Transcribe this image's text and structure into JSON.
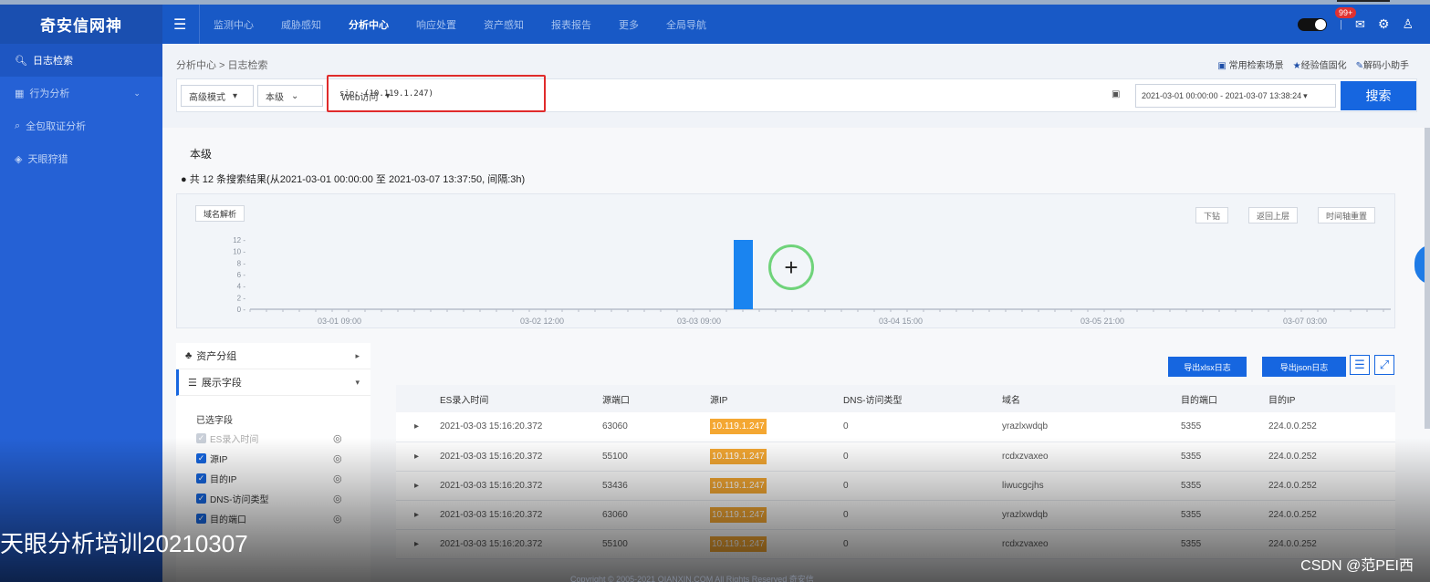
{
  "app": {
    "logo": "奇安信网神"
  },
  "nav": {
    "items": [
      "监测中心",
      "威胁感知",
      "分析中心",
      "响应处置",
      "资产感知",
      "报表报告",
      "更多",
      "全局导航"
    ],
    "active": "分析中心"
  },
  "header_right": {
    "badge": "99+"
  },
  "sidebar": {
    "items": [
      "日志检索",
      "行为分析",
      "全包取证分析",
      "天眼狩猎"
    ]
  },
  "breadcrumb": "分析中心 > 日志检索",
  "quick_links": [
    "常用检索场景",
    "经验值固化",
    "解码小助手"
  ],
  "search": {
    "mode": "高级模式",
    "level": "本级",
    "type": "Web访问",
    "query": "sip: (10.119.1.247)",
    "date_range": "2021-03-01 00:00:00 - 2021-03-07 13:38:24",
    "button": "搜索"
  },
  "result": {
    "level_title": "本级",
    "summary": "● 共 12 条搜索结果(从2021-03-01 00:00:00 至 2021-03-07 13:37:50, 间隔:3h)"
  },
  "chart": {
    "tag_button": "域名解析",
    "buttons": [
      "下钻",
      "返回上层",
      "时间轴重置"
    ]
  },
  "chart_data": {
    "type": "bar",
    "x_ticks": [
      "03-01 09:00",
      "03-02 12:00",
      "03-03 09:00",
      "03-04 15:00",
      "03-05 21:00",
      "03-07 03:00"
    ],
    "y_ticks": [
      "12",
      "10",
      "8",
      "6",
      "4",
      "2",
      "0"
    ],
    "bars": [
      {
        "x": "2021-03-03 15:00",
        "value": 12
      }
    ],
    "ylim": [
      0,
      12
    ],
    "bar_color": "#1a84f0"
  },
  "left_panel": {
    "group": "资产分组",
    "fields_title": "展示字段",
    "selected_label": "已选字段",
    "fields": [
      "ES录入时间",
      "源IP",
      "目的IP",
      "DNS-访问类型",
      "目的端口"
    ]
  },
  "export": {
    "xlsx": "导出xlsx日志",
    "json": "导出json日志"
  },
  "table": {
    "headers": [
      "ES录入时间",
      "源端口",
      "源IP",
      "DNS-访问类型",
      "域名",
      "目的端口",
      "目的IP"
    ],
    "rows": [
      [
        "2021-03-03 15:16:20.372",
        "63060",
        "10.119.1.247",
        "0",
        "yrazlxwdqb",
        "5355",
        "224.0.0.252"
      ],
      [
        "2021-03-03 15:16:20.372",
        "55100",
        "10.119.1.247",
        "0",
        "rcdxzvaxeo",
        "5355",
        "224.0.0.252"
      ],
      [
        "2021-03-03 15:16:20.372",
        "53436",
        "10.119.1.247",
        "0",
        "liwucgcjhs",
        "5355",
        "224.0.0.252"
      ],
      [
        "2021-03-03 15:16:20.372",
        "63060",
        "10.119.1.247",
        "0",
        "yrazlxwdqb",
        "5355",
        "224.0.0.252"
      ],
      [
        "2021-03-03 15:16:20.372",
        "55100",
        "10.119.1.247",
        "0",
        "rcdxzvaxeo",
        "5355",
        "224.0.0.252"
      ]
    ]
  },
  "footer": "Copyright © 2005-2021 QIANXIN.COM All Rights Reserved 奇安信",
  "watermark": {
    "left": "天眼分析培训20210307",
    "right": "CSDN @范PEI西"
  },
  "colors": {
    "topbar": "#1859c6",
    "sidebar": "#2561d5",
    "accent": "#1666e0",
    "ip_highlight": "#f4a732",
    "query_box_border": "#e02b2b"
  }
}
